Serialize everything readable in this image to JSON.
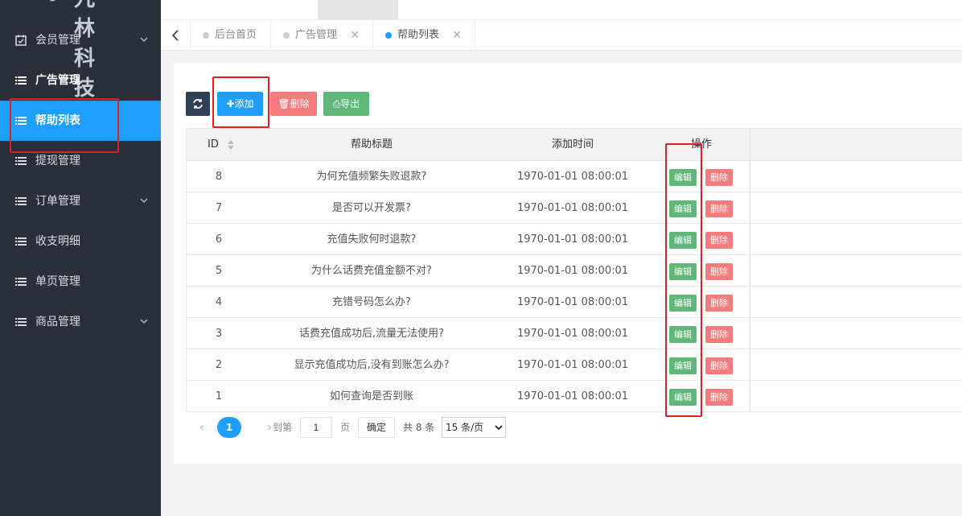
{
  "sidebar": {
    "logo": "logo",
    "brand": "九林科技",
    "items": [
      {
        "label": "会员管理",
        "has_children": true
      },
      {
        "label": "广告管理",
        "has_children": false
      },
      {
        "label": "帮助列表",
        "has_children": false
      },
      {
        "label": "提现管理",
        "has_children": false
      },
      {
        "label": "订单管理",
        "has_children": true
      },
      {
        "label": "收支明细",
        "has_children": false
      },
      {
        "label": "单页管理",
        "has_children": false
      },
      {
        "label": "商品管理",
        "has_children": true
      }
    ]
  },
  "tabs": [
    {
      "label": "后台首页",
      "closable": false
    },
    {
      "label": "广告管理",
      "closable": true
    },
    {
      "label": "帮助列表",
      "closable": true
    }
  ],
  "toolbar": {
    "add_label": "添加",
    "delete_label": "删除",
    "export_label": "导出"
  },
  "table": {
    "headers": {
      "id": "ID",
      "title": "帮助标题",
      "time": "添加时间",
      "op": "操作"
    },
    "rows": [
      {
        "id": "8",
        "title": "为何充值频繁失败退款?",
        "time": "1970-01-01 08:00:01"
      },
      {
        "id": "7",
        "title": "是否可以开发票?",
        "time": "1970-01-01 08:00:01"
      },
      {
        "id": "6",
        "title": "充值失败何时退款?",
        "time": "1970-01-01 08:00:01"
      },
      {
        "id": "5",
        "title": "为什么话费充值金额不对?",
        "time": "1970-01-01 08:00:01"
      },
      {
        "id": "4",
        "title": "充错号码怎么办?",
        "time": "1970-01-01 08:00:01"
      },
      {
        "id": "3",
        "title": "话费充值成功后,流量无法使用?",
        "time": "1970-01-01 08:00:01"
      },
      {
        "id": "2",
        "title": "显示充值成功后,没有到账怎么办?",
        "time": "1970-01-01 08:00:01"
      },
      {
        "id": "1",
        "title": "如何查询是否到账",
        "time": "1970-01-01 08:00:01"
      }
    ],
    "edit_label": "编辑",
    "delete_label": "删除"
  },
  "pager": {
    "current": "1",
    "goto_label": "到第",
    "goto_value": "1",
    "page_label": "页",
    "confirm_label": "确定",
    "total_label": "共 8 条",
    "per_page": "15 条/页"
  },
  "colors": {
    "sidebar_bg": "#2a2f3a",
    "active": "#1e9fff",
    "success": "#5fb878",
    "danger": "#f47c7c",
    "highlight": "#e02020"
  }
}
